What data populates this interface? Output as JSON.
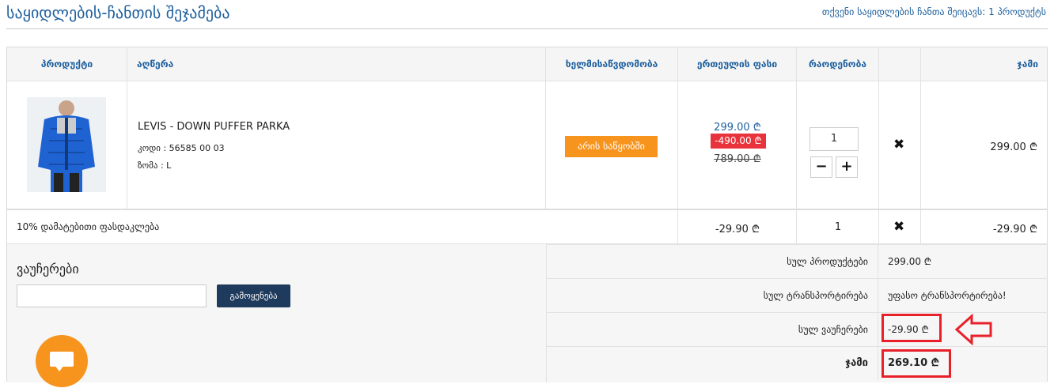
{
  "header": {
    "title": "საყიდლების-ჩანთის შეჯამება",
    "cart_info_prefix": "თქვენი საყიდლების ჩანთა შეიცავს:",
    "cart_info_count": "1",
    "cart_info_suffix": "პროდუქტს"
  },
  "table": {
    "headers": {
      "product": "პროდუქტი",
      "description": "აღწერა",
      "availability": "ხელმისაწვდომობა",
      "unit_price": "ერთეულის ფასი",
      "quantity": "რაოდენობა",
      "total": "ჯამი"
    },
    "product": {
      "name": "LEVIS - DOWN PUFFER PARKA",
      "code": "კოდი : 56585 00 03",
      "size": "ზომა : L",
      "stock_label": "არის საწყობში",
      "price_new": "299.00 ₾",
      "price_discount": "-490.00 ₾",
      "price_old": "789.00 ₾",
      "quantity": "1",
      "minus": "−",
      "plus": "+",
      "remove": "✖",
      "line_total": "299.00 ₾"
    },
    "discount_row": {
      "label": "10% დამატებითი ფასდაკლება",
      "unit_price": "-29.90 ₾",
      "quantity": "1",
      "remove": "✖",
      "total": "-29.90 ₾"
    }
  },
  "vouchers": {
    "title": "ვაუჩერები",
    "input_value": "",
    "apply_label": "გამოყენება"
  },
  "summary": {
    "products_label": "სულ პროდუქტები",
    "products_value": "299.00 ₾",
    "shipping_label": "სულ ტრანსპორტირება",
    "shipping_value": "უფასო ტრანსპორტირება!",
    "vouchers_label": "სულ ვაუჩერები",
    "vouchers_value": "-29.90 ₾",
    "total_label": "ჯამი",
    "total_value": "269.10 ₾"
  },
  "colors": {
    "accent_blue": "#1d5f9e",
    "stock_orange": "#f7941d",
    "discount_red": "#e8333c",
    "highlight_red": "#e8202a",
    "button_navy": "#1e3a5c"
  },
  "icons": [
    "remove-icon",
    "arrow-left-icon",
    "chat-icon",
    "product-image"
  ]
}
